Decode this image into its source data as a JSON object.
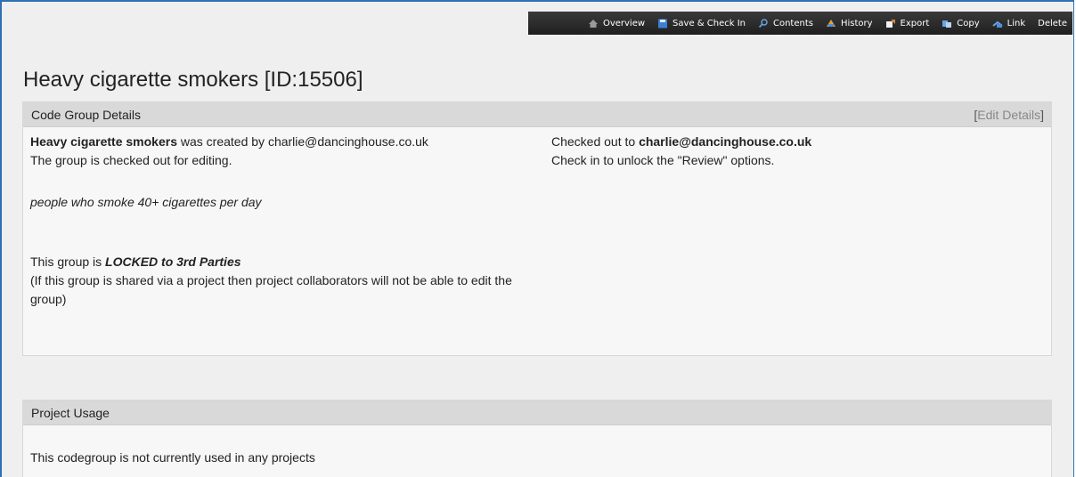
{
  "toolbar": {
    "items": [
      {
        "label": "Overview",
        "icon": "home-icon"
      },
      {
        "label": "Save & Check In",
        "icon": "save-icon"
      },
      {
        "label": "Contents",
        "icon": "search-icon"
      },
      {
        "label": "History",
        "icon": "history-icon"
      },
      {
        "label": "Export",
        "icon": "export-icon"
      },
      {
        "label": "Copy",
        "icon": "copy-icon"
      },
      {
        "label": "Link",
        "icon": "link-icon"
      },
      {
        "label": "Delete",
        "icon": ""
      }
    ]
  },
  "page": {
    "title": "Heavy cigarette smokers [ID:15506]"
  },
  "details": {
    "header": "Code Group Details",
    "edit_open": "[",
    "edit_label": "Edit Details",
    "edit_close": "]",
    "group_name": "Heavy cigarette smokers",
    "created_by_text": " was created by charlie@dancinghouse.co.uk",
    "checked_out_text": "The group is checked out for editing.",
    "description": "people who smoke 40+ cigarettes per day",
    "locked_prefix": "This group is ",
    "locked_label": "LOCKED to 3rd Parties",
    "locked_note": "(If this group is shared via a project then project collaborators will not be able to edit the group)",
    "checked_out_to_prefix": "Checked out to ",
    "checked_out_to_user": "charlie@dancinghouse.co.uk",
    "check_in_note": "Check in to unlock the \"Review\" options."
  },
  "usage": {
    "header": "Project Usage",
    "message": "This codegroup is not currently used in any projects"
  }
}
